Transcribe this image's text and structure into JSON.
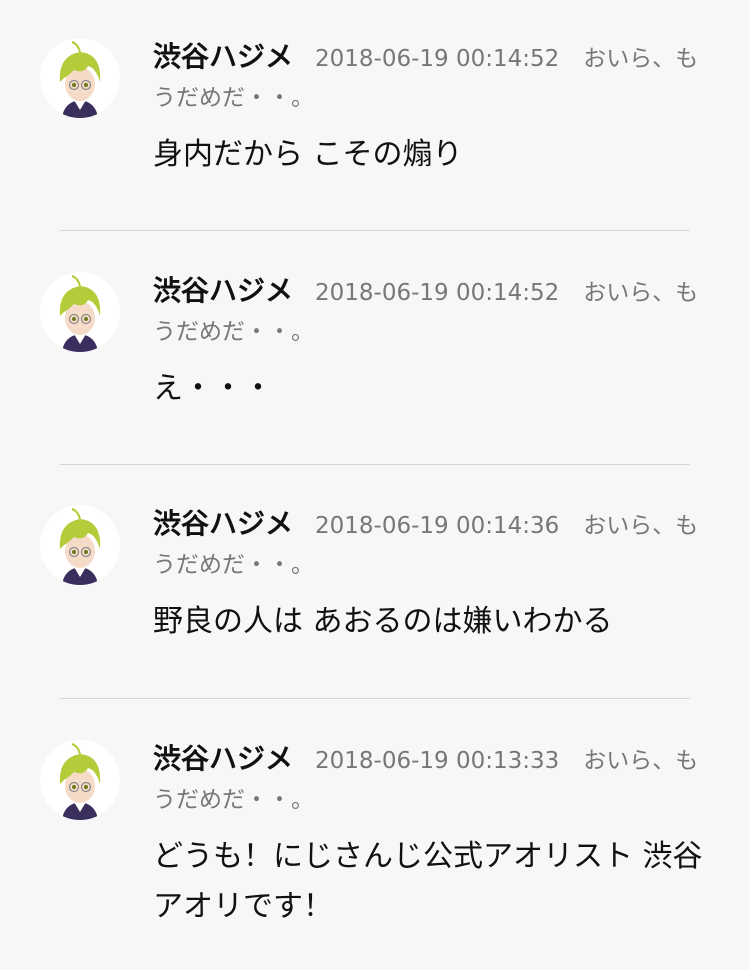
{
  "comments": [
    {
      "author": "渋谷ハジメ",
      "timestamp": "2018-06-19 00:14:52",
      "status": "おいら、もうだめだ・・。",
      "body": "身内だから こその煽り"
    },
    {
      "author": "渋谷ハジメ",
      "timestamp": "2018-06-19 00:14:52",
      "status": "おいら、もうだめだ・・。",
      "body": "え・・・"
    },
    {
      "author": "渋谷ハジメ",
      "timestamp": "2018-06-19 00:14:36",
      "status": "おいら、もうだめだ・・。",
      "body": "野良の人は あおるのは嫌いわかる"
    },
    {
      "author": "渋谷ハジメ",
      "timestamp": "2018-06-19 00:13:33",
      "status": "おいら、もうだめだ・・。",
      "body": "どうも！にじさんじ公式アオリスト 渋谷アオリです！"
    }
  ],
  "colors": {
    "background": "#f7f7f7",
    "text": "#111111",
    "muted": "#777777",
    "divider": "#d6d6d6",
    "hair": "#b5cc3a"
  },
  "icons": [
    "avatar-image"
  ]
}
